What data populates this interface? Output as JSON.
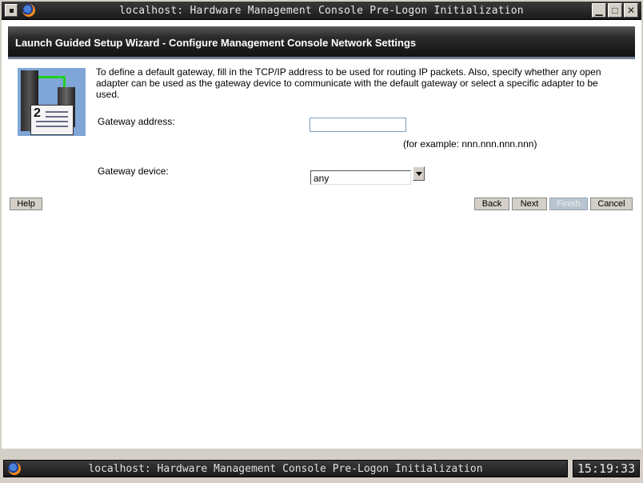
{
  "window": {
    "title": "localhost: Hardware Management Console Pre-Logon Initialization",
    "minimize_glyph": "▁",
    "maximize_glyph": "□",
    "close_glyph": "✕"
  },
  "wizard": {
    "header": "Launch Guided Setup Wizard - Configure Management Console Network Settings",
    "step_number": "2",
    "description": "To define a default gateway, fill in the TCP/IP address to be used for routing IP packets. Also, specify whether any open adapter can be used as the gateway device to communicate with the default gateway or select a specific adapter to be used.",
    "gateway_address_label": "Gateway address:",
    "gateway_address_value": "",
    "example_text": "(for example: nnn.nnn.nnn.nnn)",
    "gateway_device_label": "Gateway device:",
    "gateway_device_value": "any"
  },
  "buttons": {
    "help": "Help",
    "back": "Back",
    "next": "Next",
    "finish": "Finish",
    "cancel": "Cancel"
  },
  "taskbar": {
    "title": "localhost: Hardware Management Console Pre-Logon Initialization",
    "clock": "15:19:33"
  }
}
